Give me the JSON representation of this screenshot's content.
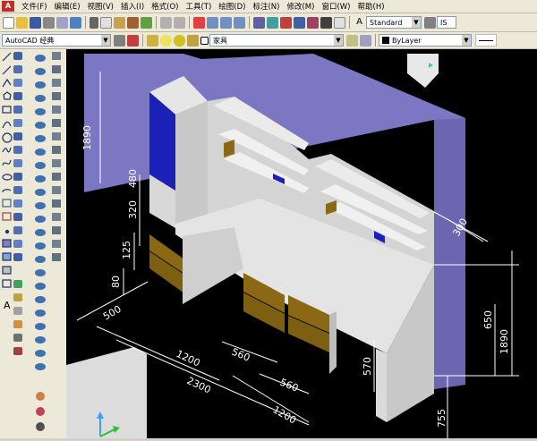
{
  "menubar": {
    "items": [
      "文件(F)",
      "编辑(E)",
      "视图(V)",
      "插入(I)",
      "格式(O)",
      "工具(T)",
      "绘图(D)",
      "标注(N)",
      "修改(M)",
      "窗口(W)",
      "帮助(H)"
    ]
  },
  "toolbar": {
    "text_style": "Standard",
    "text_style_tail": "IS",
    "workspace": "AutoCAD 经典",
    "layer": "家具",
    "color": "ByLayer"
  },
  "drawing": {
    "dimensions": {
      "d1890a": "1890",
      "d480": "480",
      "d320": "320",
      "d125": "125",
      "d80": "80",
      "d500": "500",
      "d1200a": "1200",
      "d2300": "2300",
      "d560a": "560",
      "d560b": "560",
      "d1200b": "1200",
      "d570": "570",
      "d755": "755",
      "d1890b": "1890",
      "d650": "650",
      "d300": "300"
    },
    "colors": {
      "background": "#000000",
      "wall": "#7b77c2",
      "panel": "#dcdcdc",
      "blue_door": "#1a20b8",
      "drawer": "#8b6914",
      "dim_line": "#ffffff"
    }
  }
}
